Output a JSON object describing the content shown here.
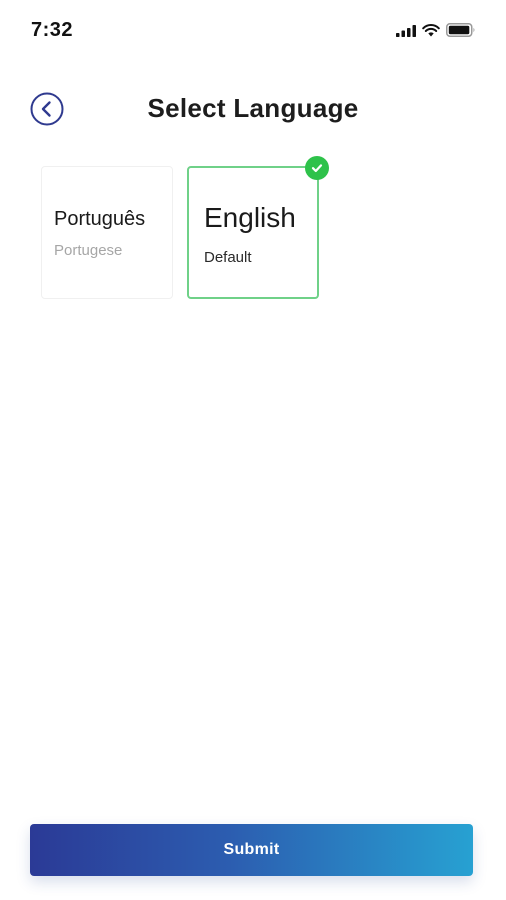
{
  "status_bar": {
    "time": "7:32",
    "icons": [
      "signal-icon",
      "wifi-icon",
      "battery-icon"
    ]
  },
  "header": {
    "title": "Select Language",
    "back_icon": "chevron-left-circle-icon"
  },
  "languages": [
    {
      "name": "Português",
      "subtitle": "Portugese",
      "selected": false
    },
    {
      "name": "English",
      "subtitle": "Default",
      "selected": true
    }
  ],
  "selected_badge_icon": "check-circle-icon",
  "submit": {
    "label": "Submit"
  },
  "colors": {
    "accent_green": "#2ec24a",
    "selected_border": "#6fd188",
    "back_icon": "#2f3a8f",
    "button_gradient_start": "#2b3a96",
    "button_gradient_end": "#27a1d2"
  }
}
